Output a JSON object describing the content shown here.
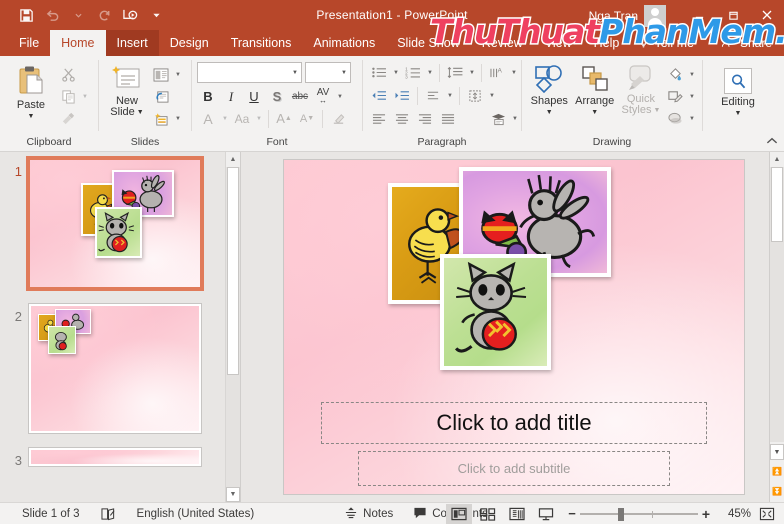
{
  "titlebar": {
    "document_title": "Presentation1  -  PowerPoint",
    "account_name": "Nga Tran",
    "qat": [
      {
        "name": "save",
        "icon": "save-icon"
      },
      {
        "name": "undo",
        "icon": "undo-icon"
      },
      {
        "name": "redo",
        "icon": "redo-icon"
      },
      {
        "name": "start-from-beginning",
        "icon": "slideshow-icon"
      },
      {
        "name": "customize-quick-access-toolbar",
        "icon": "chevron-down-icon"
      }
    ],
    "window_controls": {
      "minimize": "–",
      "restore": "❐",
      "close": "✕"
    }
  },
  "watermark": {
    "part1": "ThuThuat",
    "part2": "PhanMem.vn",
    "color1": "#ef4060",
    "color2": "#2e9ae8"
  },
  "tabs": [
    {
      "label": "File",
      "state": "file"
    },
    {
      "label": "Home",
      "state": "active"
    },
    {
      "label": "Insert",
      "state": "hover"
    },
    {
      "label": "Design",
      "state": "normal"
    },
    {
      "label": "Transitions",
      "state": "normal"
    },
    {
      "label": "Animations",
      "state": "normal"
    },
    {
      "label": "Slide Show",
      "state": "normal"
    },
    {
      "label": "Review",
      "state": "normal"
    },
    {
      "label": "View",
      "state": "normal"
    },
    {
      "label": "Help",
      "state": "normal"
    }
  ],
  "tabs_right": {
    "tell_me": "Tell me",
    "share": "Share"
  },
  "ribbon": {
    "groups": [
      {
        "label": "Clipboard",
        "has_dialog_launcher": true
      },
      {
        "label": "Slides",
        "has_dialog_launcher": false
      },
      {
        "label": "Font",
        "has_dialog_launcher": true
      },
      {
        "label": "Paragraph",
        "has_dialog_launcher": true
      },
      {
        "label": "Drawing",
        "has_dialog_launcher": true
      }
    ],
    "clipboard": {
      "paste_label": "Paste",
      "cut_label": "Cut",
      "copy_label": "Copy",
      "format_painter_label": "Format Painter"
    },
    "slides": {
      "new_slide_label": "New\nSlide",
      "new_slide_line1": "New",
      "new_slide_line2": "Slide",
      "layout_label": "Layout",
      "reset_label": "Reset",
      "section_label": "Section"
    },
    "font": {
      "font_name_value": "",
      "font_size_value": "",
      "bold": "B",
      "italic": "I",
      "underline": "U",
      "shadow": "S",
      "strikethrough": "abc",
      "character_spacing": "AV",
      "font_color": "A",
      "change_case": "Aa",
      "increase_size": "A",
      "decrease_size": "A",
      "clear_formatting": "clear-formatting"
    },
    "paragraph": {
      "bullets": "bullets",
      "numbering": "numbering",
      "decrease_indent": "decrease-indent",
      "increase_indent": "increase-indent",
      "line_spacing": "line-spacing",
      "text_direction": "text-direction",
      "align_text": "align-text",
      "convert_to_smartart": "convert-to-smartart",
      "align_left": "align-left",
      "center": "center",
      "align_right": "align-right",
      "justify": "justify",
      "columns": "columns"
    },
    "drawing": {
      "shapes_label": "Shapes",
      "arrange_label": "Arrange",
      "quick_styles_line1": "Quick",
      "quick_styles_line2": "Styles",
      "quick_styles_disabled": true,
      "shape_fill": "shape-fill",
      "shape_outline": "shape-outline",
      "shape_effects": "shape-effects"
    },
    "editing": {
      "label": "Editing",
      "find_icon": "magnifier-icon"
    },
    "collapse_ribbon": "collapse-ribbon"
  },
  "slides_panel": {
    "slides": [
      {
        "number": "1",
        "selected": true,
        "layout": "three-pictures-centered"
      },
      {
        "number": "2",
        "selected": false,
        "layout": "three-pictures-corner"
      },
      {
        "number": "3",
        "selected": false,
        "layout": "partial"
      }
    ]
  },
  "slide_canvas": {
    "background_color": "#fcc9d2",
    "title_placeholder": "Click to add title",
    "subtitle_placeholder": "Click to add subtitle",
    "pictures": [
      {
        "name": "chick-picture",
        "subject": "yellow chick",
        "frame_color": "#e0a820"
      },
      {
        "name": "bunny-picture",
        "subject": "grey bunny with easter eggs",
        "frame_color": "#e8a0d8"
      },
      {
        "name": "kitten-picture",
        "subject": "grey kitten with red easter egg",
        "frame_color": "#bddc9a"
      }
    ]
  },
  "status_bar": {
    "slide_indicator": "Slide 1 of 3",
    "spellcheck_icon": "spellcheck-icon",
    "language": "English (United States)",
    "notes_label": "Notes",
    "comments_label": "Comments",
    "views": [
      {
        "name": "normal-view",
        "active": true
      },
      {
        "name": "slide-sorter-view",
        "active": false
      },
      {
        "name": "reading-view",
        "active": false
      },
      {
        "name": "slideshow-view",
        "active": false
      }
    ],
    "zoom_out": "−",
    "zoom_in": "+",
    "zoom_level": "45%",
    "fit_to_window": "fit-to-window-icon"
  }
}
